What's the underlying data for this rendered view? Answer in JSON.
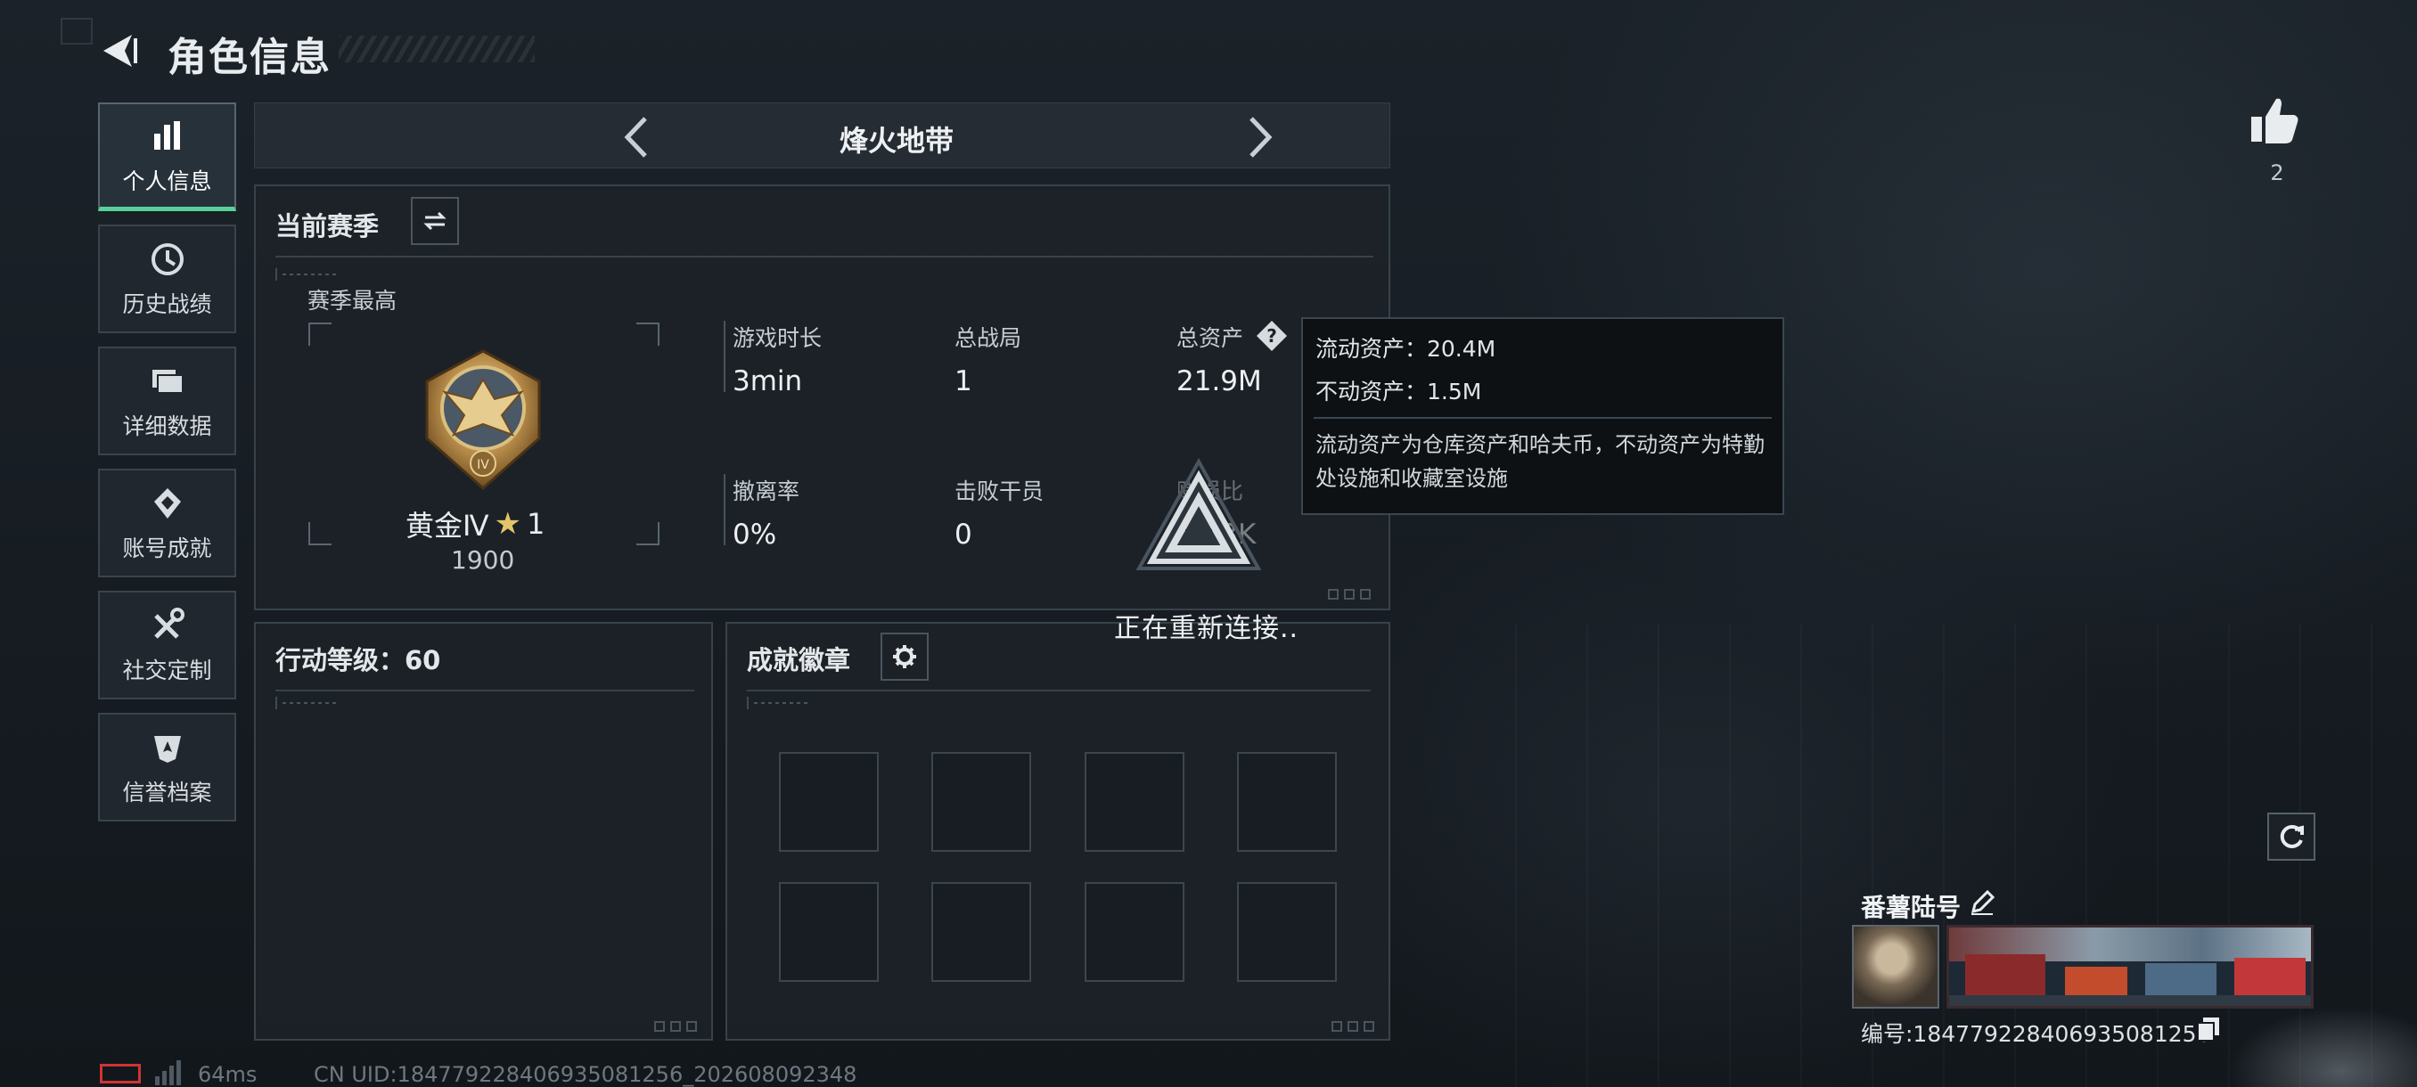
{
  "header": {
    "title": "角色信息"
  },
  "sidebar": {
    "items": [
      {
        "label": "个人信息",
        "icon": "bar-chart-icon",
        "active": true
      },
      {
        "label": "历史战绩",
        "icon": "clock-history-icon"
      },
      {
        "label": "详细数据",
        "icon": "folder-icon"
      },
      {
        "label": "账号成就",
        "icon": "achievement-icon"
      },
      {
        "label": "社交定制",
        "icon": "tools-icon"
      },
      {
        "label": "信誉档案",
        "icon": "shield-badge-icon"
      }
    ]
  },
  "mode": {
    "title": "烽火地带"
  },
  "season": {
    "heading": "当前赛季",
    "best_label": "赛季最高",
    "rank_name": "黄金Ⅳ",
    "rank_stars": "1",
    "rank_points": "1900",
    "medal_text": "IV"
  },
  "stats": [
    {
      "label": "游戏时长",
      "value": "3min"
    },
    {
      "label": "总战局",
      "value": "1"
    },
    {
      "label": "总资产",
      "value": "21.9M"
    },
    {
      "label": "撤离率",
      "value": "0%"
    },
    {
      "label": "击败干员",
      "value": "0"
    },
    {
      "label": "赚损比",
      "value": "35.3K"
    }
  ],
  "tooltip": {
    "liquid": "流动资产：20.4M",
    "fixed": "不动资产：1.5M",
    "description": "流动资产为仓库资产和哈夫币，不动资产为特勤处设施和收藏室设施"
  },
  "reconnect": {
    "text": "正在重新连接.."
  },
  "action_level": {
    "heading": "行动等级：60"
  },
  "badges": {
    "heading": "成就徽章"
  },
  "likes": {
    "count": "2"
  },
  "player": {
    "name": "番薯陆号",
    "id_line": "编号:1847792284069350812​56"
  },
  "footer": {
    "ping": "64ms",
    "uid": "CN UID:1847792284069350812​56_202608092348"
  },
  "colors": {
    "accent": "#57d19a",
    "battery_low": "#d03434",
    "rank_star": "#e4c46a"
  }
}
